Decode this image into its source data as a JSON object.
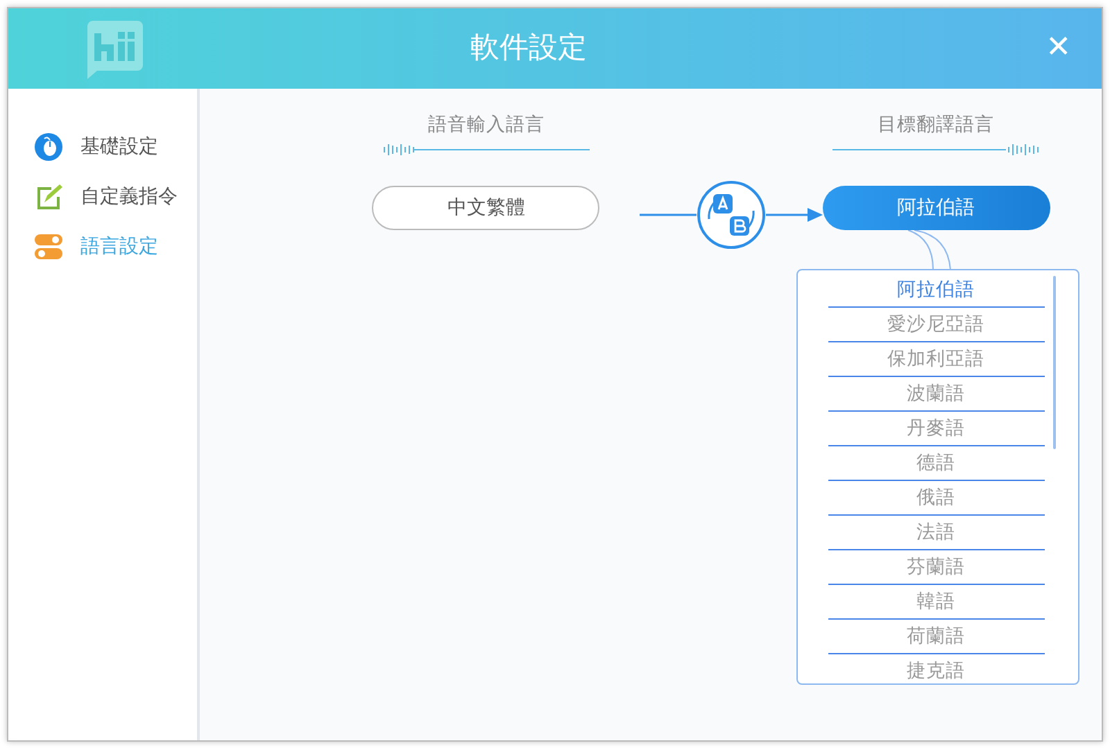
{
  "window": {
    "title": "軟件設定",
    "close": "✕"
  },
  "sidebar": {
    "items": [
      {
        "label": "基礎設定",
        "selected": false,
        "kind": "mouse"
      },
      {
        "label": "自定義指令",
        "selected": false,
        "kind": "edit"
      },
      {
        "label": "語言設定",
        "selected": true,
        "kind": "toggle"
      }
    ]
  },
  "source": {
    "heading": "語音輸入語言",
    "language": "中文繁體"
  },
  "target": {
    "heading": "目標翻譯語言",
    "language": "阿拉伯語",
    "options": [
      {
        "label": "阿拉伯語",
        "selected": true
      },
      {
        "label": "愛沙尼亞語",
        "selected": false
      },
      {
        "label": "保加利亞語",
        "selected": false
      },
      {
        "label": "波蘭語",
        "selected": false
      },
      {
        "label": "丹麥語",
        "selected": false
      },
      {
        "label": "德語",
        "selected": false
      },
      {
        "label": "俄語",
        "selected": false
      },
      {
        "label": "法語",
        "selected": false
      },
      {
        "label": "芬蘭語",
        "selected": false
      },
      {
        "label": "韓語",
        "selected": false
      },
      {
        "label": "荷蘭語",
        "selected": false
      },
      {
        "label": "捷克語",
        "selected": false
      }
    ]
  }
}
